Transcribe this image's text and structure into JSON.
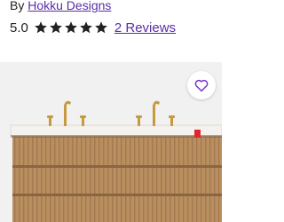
{
  "brand": {
    "prefix": "By ",
    "name": "Hokku Designs"
  },
  "rating": {
    "value": "5.0",
    "stars": 5,
    "reviews_label": "2 Reviews"
  },
  "icons": {
    "star": "star-icon",
    "favorite": "heart-outline-icon"
  },
  "colors": {
    "link": "#5a2ea6",
    "star": "#222222",
    "image_background": "#f1f1f1",
    "countertop": "#f4f2ee",
    "wood": "#b98f5f",
    "faucet_gold": "#c79a3e",
    "heart": "#7a2fc8"
  }
}
